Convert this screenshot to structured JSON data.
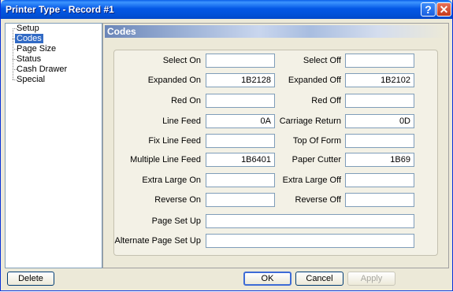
{
  "window": {
    "title": "Printer Type - Record #1",
    "help_glyph": "?",
    "close_glyph": "✕"
  },
  "tree": {
    "items": [
      {
        "label": "Setup",
        "selected": false
      },
      {
        "label": "Codes",
        "selected": true
      },
      {
        "label": "Page Size",
        "selected": false
      },
      {
        "label": "Status",
        "selected": false
      },
      {
        "label": "Cash Drawer",
        "selected": false
      },
      {
        "label": "Special",
        "selected": false
      }
    ]
  },
  "panel": {
    "title": "Codes"
  },
  "fields": {
    "select_on": {
      "label": "Select On",
      "value": ""
    },
    "select_off": {
      "label": "Select Off",
      "value": ""
    },
    "expanded_on": {
      "label": "Expanded On",
      "value": "1B2128"
    },
    "expanded_off": {
      "label": "Expanded Off",
      "value": "1B2102"
    },
    "red_on": {
      "label": "Red On",
      "value": ""
    },
    "red_off": {
      "label": "Red Off",
      "value": ""
    },
    "line_feed": {
      "label": "Line Feed",
      "value": "0A"
    },
    "carriage_return": {
      "label": "Carriage Return",
      "value": "0D"
    },
    "fix_line_feed": {
      "label": "Fix Line Feed",
      "value": ""
    },
    "top_of_form": {
      "label": "Top Of Form",
      "value": ""
    },
    "multiple_line_feed": {
      "label": "Multiple Line Feed",
      "value": "1B6401"
    },
    "paper_cutter": {
      "label": "Paper Cutter",
      "value": "1B69"
    },
    "extra_large_on": {
      "label": "Extra Large On",
      "value": ""
    },
    "extra_large_off": {
      "label": "Extra Large Off",
      "value": ""
    },
    "reverse_on": {
      "label": "Reverse On",
      "value": ""
    },
    "reverse_off": {
      "label": "Reverse Off",
      "value": ""
    },
    "page_set_up": {
      "label": "Page Set Up",
      "value": ""
    },
    "alternate_page_set_up": {
      "label": "Alternate Page Set Up",
      "value": ""
    }
  },
  "buttons": {
    "delete": "Delete",
    "ok": "OK",
    "cancel": "Cancel",
    "apply": "Apply"
  },
  "colors": {
    "title_bar": "#0054e3",
    "selection": "#316ac5",
    "dialog_bg": "#ece9d8"
  }
}
